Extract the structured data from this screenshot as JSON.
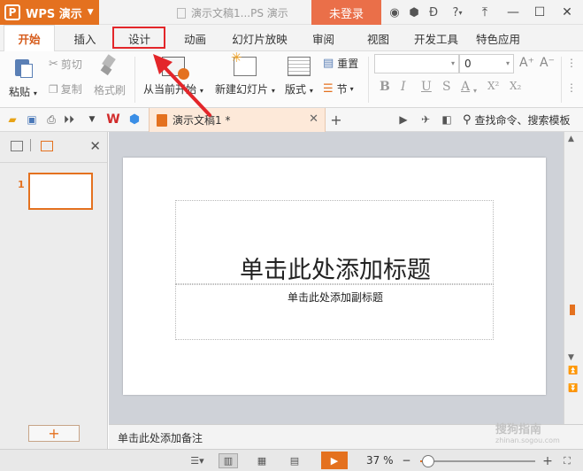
{
  "titlebar": {
    "app_logo": "P",
    "app_name": "WPS 演示",
    "doc_title": "演示文稿1...PS 演示",
    "login": "未登录",
    "icons": [
      "skin-icon",
      "cube-icon",
      "share-icon",
      "help-icon"
    ],
    "help": "?"
  },
  "menu": {
    "tabs": [
      "开始",
      "插入",
      "设计",
      "动画",
      "幻灯片放映",
      "审阅",
      "视图",
      "开发工具",
      "特色应用"
    ],
    "active": "开始",
    "highlighted": "设计"
  },
  "ribbon": {
    "paste": "粘贴",
    "cut": "剪切",
    "copy": "复制",
    "format_painter": "格式刷",
    "from_current": "从当前开始",
    "new_slide": "新建幻灯片",
    "layout": "版式",
    "reset": "重置",
    "section": "节",
    "font_size": "0",
    "bold": "B",
    "italic": "I",
    "underline": "U",
    "strike": "S",
    "font_color": "A",
    "superscript": "X²",
    "subscript": "X₂",
    "grow": "A⁺",
    "shrink": "A⁻"
  },
  "quickbar": {
    "doc_tab": "演示文稿1 *",
    "search": "查找命令、搜索模板"
  },
  "leftpanel": {
    "slide_number": "1",
    "add_slide": "+"
  },
  "slide": {
    "title_placeholder": "单击此处添加标题",
    "subtitle_placeholder": "单击此处添加副标题"
  },
  "notes": {
    "placeholder": "单击此处添加备注"
  },
  "watermark": {
    "text": "搜狗指南",
    "url": "zhinan.sogou.com"
  },
  "statusbar": {
    "zoom": "37 %",
    "zoom_value": 0.37,
    "minus": "−",
    "plus": "+"
  },
  "colors": {
    "accent": "#e4711f",
    "login_bg": "#ea6f49",
    "highlight": "#e3262a"
  }
}
